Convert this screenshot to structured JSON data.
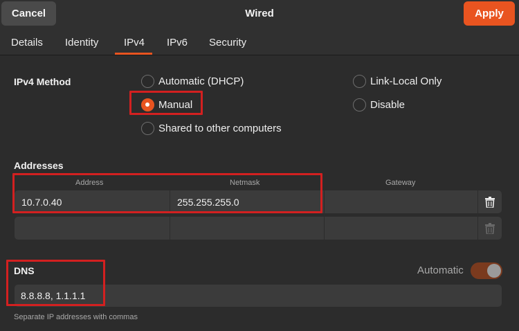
{
  "header": {
    "cancel_label": "Cancel",
    "title": "Wired",
    "apply_label": "Apply",
    "accent_color": "#e95420"
  },
  "tabs": [
    {
      "label": "Details"
    },
    {
      "label": "Identity"
    },
    {
      "label": "IPv4",
      "active": true
    },
    {
      "label": "IPv6"
    },
    {
      "label": "Security"
    }
  ],
  "ipv4_method": {
    "label": "IPv4 Method",
    "options": [
      {
        "label": "Automatic (DHCP)",
        "checked": false
      },
      {
        "label": "Manual",
        "checked": true
      },
      {
        "label": "Shared to other computers",
        "checked": false
      },
      {
        "label": "Link-Local Only",
        "checked": false
      },
      {
        "label": "Disable",
        "checked": false
      }
    ]
  },
  "addresses": {
    "label": "Addresses",
    "columns": [
      "Address",
      "Netmask",
      "Gateway"
    ],
    "rows": [
      {
        "address": "10.7.0.40",
        "netmask": "255.255.255.0",
        "gateway": ""
      },
      {
        "address": "",
        "netmask": "",
        "gateway": ""
      }
    ],
    "delete_icon": "trash-icon"
  },
  "dns": {
    "label": "DNS",
    "automatic_label": "Automatic",
    "automatic_on": true,
    "value": "8.8.8.8, 1.1.1.1",
    "hint": "Separate IP addresses with commas"
  },
  "highlight_color": "#d32020"
}
